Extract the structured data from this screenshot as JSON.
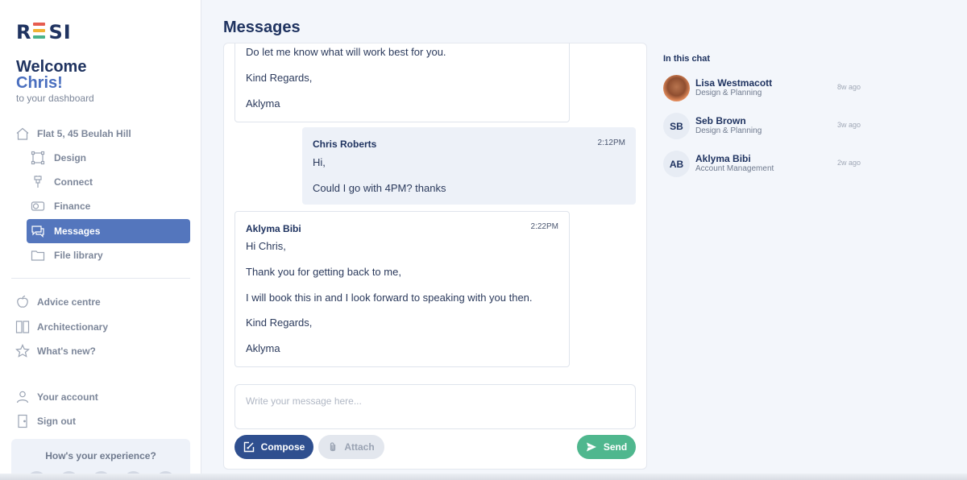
{
  "brand": {
    "logo": "RESI"
  },
  "welcome": {
    "line1": "Welcome",
    "name": "Chris!",
    "sub": "to your dashboard"
  },
  "sidebar": {
    "property": {
      "label": "Flat 5, 45 Beulah Hill",
      "icon": "house-icon"
    },
    "items": [
      {
        "label": "Design",
        "icon": "design-frame-icon"
      },
      {
        "label": "Connect",
        "icon": "plug-icon"
      },
      {
        "label": "Finance",
        "icon": "coins-icon"
      },
      {
        "label": "Messages",
        "icon": "chat-icon",
        "active": true
      },
      {
        "label": "File library",
        "icon": "folder-icon"
      }
    ],
    "secondary": [
      {
        "label": "Advice centre",
        "icon": "apple-icon"
      },
      {
        "label": "Architectionary",
        "icon": "book-icon"
      },
      {
        "label": "What's new?",
        "icon": "star-icon"
      }
    ],
    "account": [
      {
        "label": "Your account",
        "icon": "user-icon"
      },
      {
        "label": "Sign out",
        "icon": "door-icon"
      }
    ],
    "feedback": {
      "question": "How's your experience?"
    }
  },
  "page": {
    "title": "Messages"
  },
  "messages": [
    {
      "sender": "",
      "time": "",
      "lines": [
        "Do let me know what will work best for you.",
        "Kind Regards,",
        "Aklyma"
      ]
    },
    {
      "sender": "Chris Roberts",
      "time": "2:12PM",
      "lines": [
        "Hi,",
        "Could I go with 4PM? thanks"
      ]
    },
    {
      "sender": "Aklyma Bibi",
      "time": "2:22PM",
      "lines": [
        "Hi Chris,",
        "Thank you for getting back to me,",
        "I will book this in and I look forward to speaking with you then.",
        "Kind Regards,",
        "Aklyma"
      ]
    }
  ],
  "composer": {
    "placeholder": "Write your message here...",
    "compose_label": "Compose",
    "attach_label": "Attach",
    "send_label": "Send"
  },
  "in_chat": {
    "title": "In this chat",
    "participants": [
      {
        "initials": "",
        "name": "Lisa Westmacott",
        "role": "Design & Planning",
        "ago": "8w ago"
      },
      {
        "initials": "SB",
        "name": "Seb Brown",
        "role": "Design & Planning",
        "ago": "3w ago"
      },
      {
        "initials": "AB",
        "name": "Aklyma Bibi",
        "role": "Account Management",
        "ago": "2w ago"
      }
    ]
  },
  "colors": {
    "accent": "#5476bd",
    "brand_navy": "#1f3360",
    "send_green": "#4fb78e",
    "compose_navy": "#2f4f8f"
  }
}
